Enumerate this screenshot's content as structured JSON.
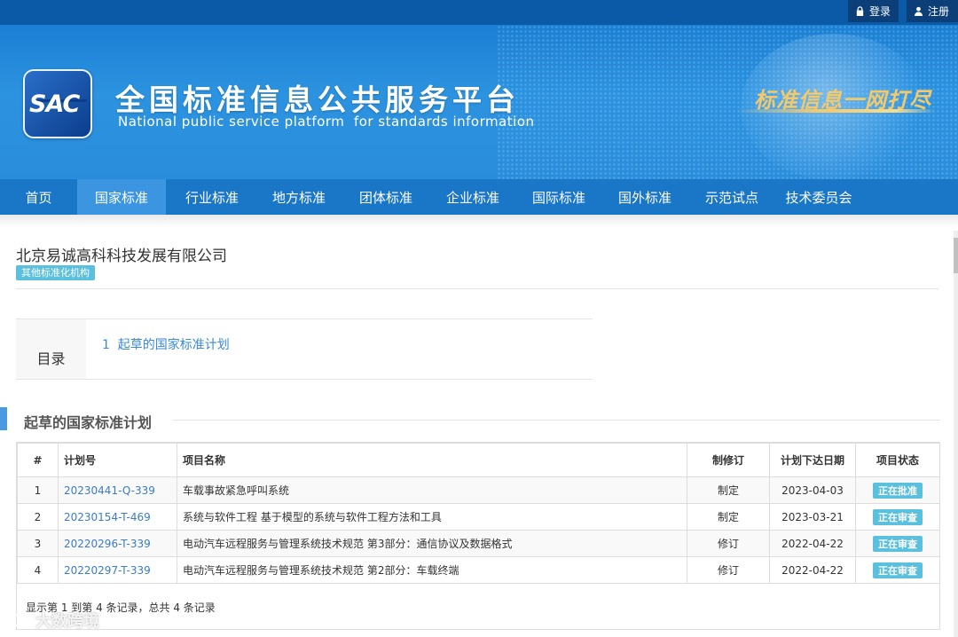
{
  "topbar": {
    "login_label": "登录",
    "register_label": "注册"
  },
  "header": {
    "logo_text": "SAC",
    "title": "全国标准信息公共服务平台",
    "subtitle": "National public service platform  for standards information",
    "slogan": "标准信息一网打尽"
  },
  "nav": {
    "items": [
      {
        "label": "首页",
        "active": false
      },
      {
        "label": "国家标准",
        "active": true
      },
      {
        "label": "行业标准",
        "active": false
      },
      {
        "label": "地方标准",
        "active": false
      },
      {
        "label": "团体标准",
        "active": false
      },
      {
        "label": "企业标准",
        "active": false
      },
      {
        "label": "国际标准",
        "active": false
      },
      {
        "label": "国外标准",
        "active": false
      },
      {
        "label": "示范试点",
        "active": false
      },
      {
        "label": "技术委员会",
        "active": false
      }
    ]
  },
  "org": {
    "name": "北京易诚高科科技发展有限公司",
    "badge": "其他标准化机构"
  },
  "toc": {
    "label": "目录",
    "item": "1  起草的国家标准计划"
  },
  "section": {
    "title": "起草的国家标准计划"
  },
  "table": {
    "headers": [
      "#",
      "计划号",
      "项目名称",
      "制修订",
      "计划下达日期",
      "项目状态"
    ],
    "rows": [
      {
        "no": "1",
        "plan_no": "20230441-Q-339",
        "name": "车载事故紧急呼叫系统",
        "type": "制定",
        "date": "2023-04-03",
        "status": "正在批准"
      },
      {
        "no": "2",
        "plan_no": "20230154-T-469",
        "name": "系统与软件工程 基于模型的系统与软件工程方法和工具",
        "type": "制定",
        "date": "2023-03-21",
        "status": "正在审查"
      },
      {
        "no": "3",
        "plan_no": "20220296-T-339",
        "name": "电动汽车远程服务与管理系统技术规范 第3部分：通信协议及数据格式",
        "type": "修订",
        "date": "2022-04-22",
        "status": "正在审查"
      },
      {
        "no": "4",
        "plan_no": "20220297-T-339",
        "name": "电动汽车远程服务与管理系统技术规范 第2部分：车载终端",
        "type": "修订",
        "date": "2022-04-22",
        "status": "正在审查"
      }
    ],
    "footer": "显示第 1 到第 4 条记录，总共 4 条记录"
  },
  "watermark": "大数跨境",
  "colors": {
    "topbar": "#0a5aa8",
    "nav": "#1a76c6",
    "nav_active": "#3b95e0",
    "badge": "#5bc0de",
    "link": "#3a7cc8"
  }
}
